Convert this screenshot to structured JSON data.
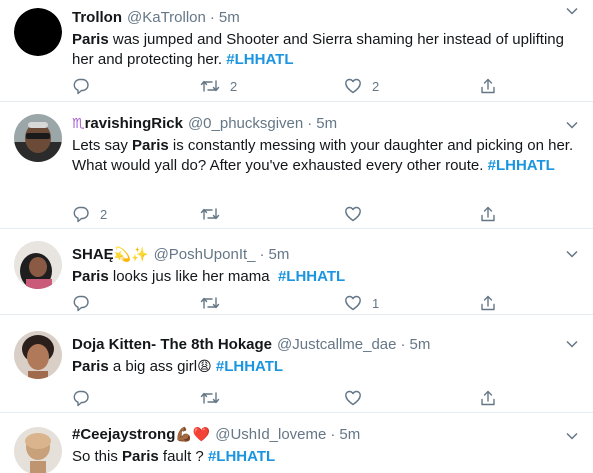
{
  "tweets": [
    {
      "name": "Trollon",
      "handle": "@KaTrollon",
      "time": "5m",
      "segments": [
        {
          "text": "Paris",
          "style": "bold"
        },
        {
          "text": " was jumped and Shooter and Sierra shaming her instead of uplifting her and protecting her. ",
          "style": "plain"
        },
        {
          "text": "#LHHATL",
          "style": "tag"
        }
      ],
      "reply_count": "",
      "retweet_count": "2",
      "like_count": "2"
    },
    {
      "name_prefix": "♏",
      "name": "ravishingRick",
      "handle": "@0_phucksgiven",
      "time": "5m",
      "segments": [
        {
          "text": "Lets say ",
          "style": "plain"
        },
        {
          "text": "Paris",
          "style": "bold"
        },
        {
          "text": " is constantly messing with your daughter and picking on her. What would yall do? After you've exhausted every other route. ",
          "style": "plain"
        },
        {
          "text": "#LHHATL",
          "style": "tag"
        }
      ],
      "reply_count": "2",
      "retweet_count": "",
      "like_count": ""
    },
    {
      "name": "SHAĘ",
      "name_suffix": "💫✨",
      "handle": "@PoshUponIt_",
      "time": "5m",
      "segments": [
        {
          "text": "Paris",
          "style": "bold"
        },
        {
          "text": " looks jus like her mama  ",
          "style": "plain"
        },
        {
          "text": "#LHHATL",
          "style": "tag"
        }
      ],
      "reply_count": "",
      "retweet_count": "",
      "like_count": "1"
    },
    {
      "name": "Doja Kitten- The 8th Hokage",
      "handle": "@Justcallme_dae",
      "time": "5m",
      "segments": [
        {
          "text": "Paris",
          "style": "bold"
        },
        {
          "text": " a big ass girl",
          "style": "plain"
        },
        {
          "text": "😩",
          "style": "emoji"
        },
        {
          "text": " ",
          "style": "plain"
        },
        {
          "text": "#LHHATL",
          "style": "tag"
        }
      ],
      "reply_count": "",
      "retweet_count": "",
      "like_count": ""
    },
    {
      "name": "#Ceejaystrong",
      "name_suffix": "💪🏾❤️",
      "handle": "@UshId_loveme",
      "time": "5m",
      "segments": [
        {
          "text": "So this ",
          "style": "plain"
        },
        {
          "text": "Paris",
          "style": "bold"
        },
        {
          "text": " fault ? ",
          "style": "plain"
        },
        {
          "text": "#LHHATL",
          "style": "tag"
        }
      ],
      "reply_count": "",
      "retweet_count": "",
      "like_count": ""
    }
  ],
  "ui": {
    "separator": "·",
    "icons": [
      "reply-icon",
      "retweet-icon",
      "like-icon",
      "share-icon",
      "chevron-down-icon"
    ]
  },
  "colors": {
    "text": "#14171a",
    "muted": "#657786",
    "hashtag": "#1b95e0",
    "divider": "#e6ecf0"
  }
}
